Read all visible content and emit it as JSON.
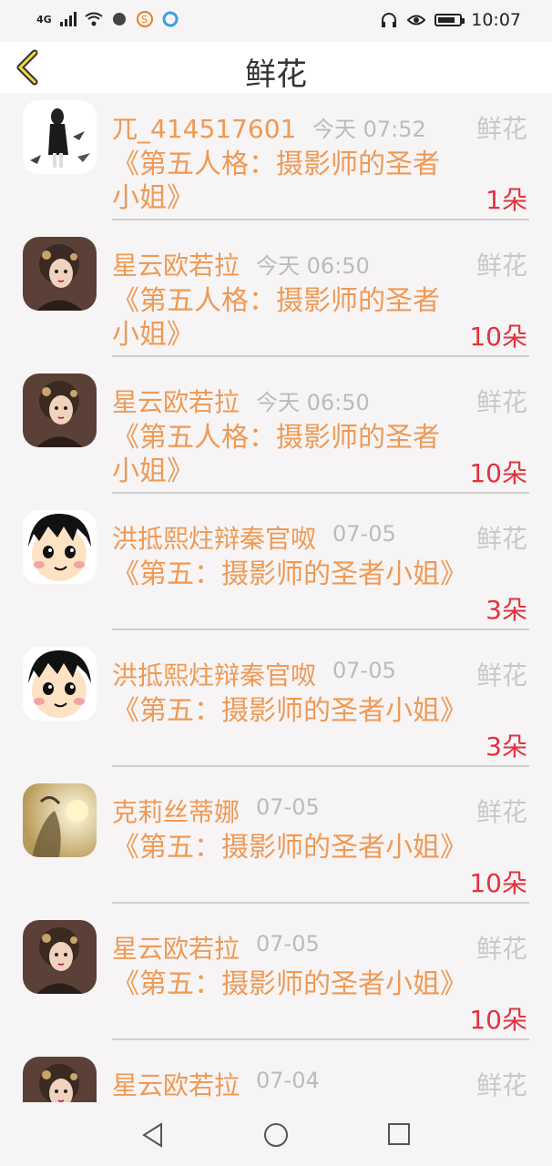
{
  "status": {
    "network": "4G",
    "time": "10:07"
  },
  "header": {
    "title": "鲜花"
  },
  "items": [
    {
      "name": "兀_414517601",
      "time": "今天 07:52",
      "type": "鲜花",
      "desc": "《第五人格：摄影师的圣者小姐》",
      "count": "1朵",
      "avatar": "girl-standing"
    },
    {
      "name": "星云欧若拉",
      "time": "今天 06:50",
      "type": "鲜花",
      "desc": "《第五人格：摄影师的圣者小姐》",
      "count": "10朵",
      "avatar": "lady-brown"
    },
    {
      "name": "星云欧若拉",
      "time": "今天 06:50",
      "type": "鲜花",
      "desc": "《第五人格：摄影师的圣者小姐》",
      "count": "10朵",
      "avatar": "lady-brown"
    },
    {
      "name": "洪抵熙炷辩秦官呶",
      "time": "07-05",
      "type": "鲜花",
      "desc": "《第五：摄影师的圣者小姐》",
      "count": "3朵",
      "avatar": "cartoon-face"
    },
    {
      "name": "洪抵熙炷辩秦官呶",
      "time": "07-05",
      "type": "鲜花",
      "desc": "《第五：摄影师的圣者小姐》",
      "count": "3朵",
      "avatar": "cartoon-face"
    },
    {
      "name": "克莉丝蒂娜",
      "time": "07-05",
      "type": "鲜花",
      "desc": "《第五：摄影师的圣者小姐》",
      "count": "10朵",
      "avatar": "golden-art"
    },
    {
      "name": "星云欧若拉",
      "time": "07-05",
      "type": "鲜花",
      "desc": "《第五：摄影师的圣者小姐》",
      "count": "10朵",
      "avatar": "lady-brown"
    },
    {
      "name": "星云欧若拉",
      "time": "07-04",
      "type": "鲜花",
      "desc": "",
      "count": "",
      "avatar": "lady-brown"
    }
  ]
}
